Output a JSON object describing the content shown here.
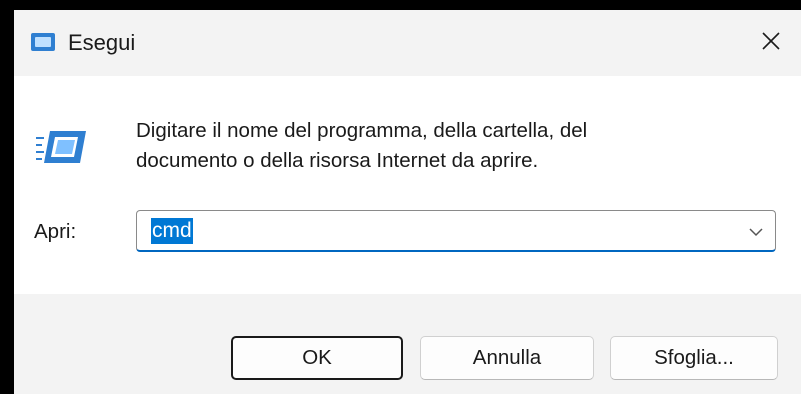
{
  "window": {
    "title": "Esegui",
    "title_icon": "run-dialog-icon",
    "close_icon": "close-icon"
  },
  "content": {
    "icon": "run-dialog-icon",
    "description": "Digitare il nome del programma, della cartella, del\ndocumento o della risorsa Internet da aprire.",
    "open_label": "Apri:",
    "open_value": "cmd",
    "dropdown_icon": "chevron-down-icon"
  },
  "buttons": {
    "ok": "OK",
    "cancel": "Annulla",
    "browse": "Sfoglia..."
  },
  "colors": {
    "accent": "#0078d4",
    "icon_blue": "#2f7fd1",
    "selection": "#0078d4"
  }
}
